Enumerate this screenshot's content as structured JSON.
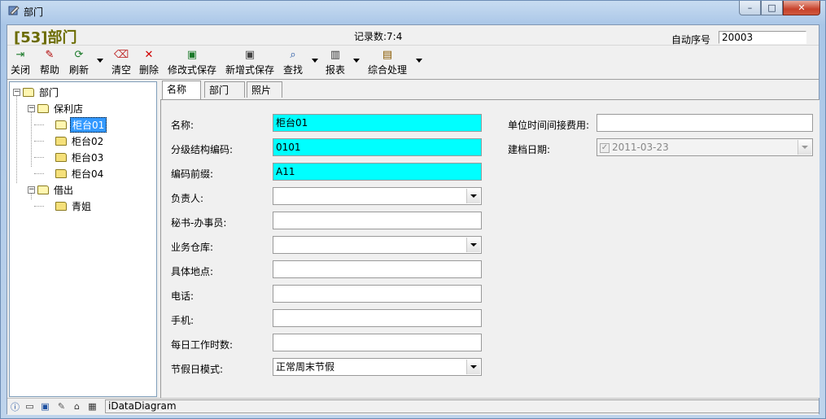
{
  "window": {
    "title": "部门",
    "controls": {
      "minimize": "–",
      "maximize": "□",
      "close": "✕"
    }
  },
  "header": {
    "page_title": "[53]部门",
    "record_count": "记录数:7:4",
    "auto_seq_label": "自动序号",
    "auto_seq_value": "20003"
  },
  "toolbar": {
    "items": [
      {
        "label": "关闭",
        "icon": "exit-door-icon",
        "glyph": "⇥"
      },
      {
        "label": "帮助",
        "icon": "help-book-icon",
        "glyph": "✎"
      },
      {
        "label": "刷新",
        "icon": "refresh-icon",
        "glyph": "⟳"
      },
      {
        "label": "清空",
        "icon": "eraser-icon",
        "glyph": "⌫"
      },
      {
        "label": "删除",
        "icon": "delete-x-icon",
        "glyph": "✕"
      },
      {
        "label": "修改式保存",
        "icon": "save-edit-icon",
        "glyph": "▣"
      },
      {
        "label": "新增式保存",
        "icon": "save-new-icon",
        "glyph": "▣"
      },
      {
        "label": "查找",
        "icon": "search-magnifier-icon",
        "glyph": "⌕"
      },
      {
        "label": "报表",
        "icon": "report-icon",
        "glyph": "▥"
      },
      {
        "label": "综合处理",
        "icon": "process-icon",
        "glyph": "▤"
      }
    ]
  },
  "tree": {
    "root": "部门",
    "groups": [
      {
        "label": "保利店",
        "children": [
          "柜台01",
          "柜台02",
          "柜台03",
          "柜台04"
        ]
      },
      {
        "label": "借出",
        "children": [
          "青姐"
        ]
      }
    ],
    "selected": "柜台01"
  },
  "tabs": [
    "名称",
    "部门类.",
    "照片"
  ],
  "form": {
    "left": [
      {
        "label": "名称:",
        "value": "柜台01",
        "type": "text",
        "highlight": true
      },
      {
        "label": "分级结构编码:",
        "value": "0101",
        "type": "text",
        "highlight": true
      },
      {
        "label": "编码前缀:",
        "value": "A11",
        "type": "text",
        "highlight": true
      },
      {
        "label": "负责人:",
        "value": "",
        "type": "select"
      },
      {
        "label": "秘书-办事员:",
        "value": "",
        "type": "text"
      },
      {
        "label": "业务仓库:",
        "value": "",
        "type": "select"
      },
      {
        "label": "具体地点:",
        "value": "",
        "type": "text"
      },
      {
        "label": "电话:",
        "value": "",
        "type": "text"
      },
      {
        "label": "手机:",
        "value": "",
        "type": "text"
      },
      {
        "label": "每日工作时数:",
        "value": "",
        "type": "text"
      },
      {
        "label": "节假日模式:",
        "value": "正常周末节假",
        "type": "select"
      }
    ],
    "right": {
      "cost_label": "单位时间间接费用:",
      "cost_value": "",
      "date_label": "建档日期:",
      "date_value": "2011-03-23"
    }
  },
  "colors": {
    "highlight_field": "#00ffff",
    "title_color": "#6b6b00",
    "selection": "#3399ff"
  },
  "statusbar": {
    "icons": [
      "info-icon",
      "computer-icon",
      "window-icon",
      "edit-icon",
      "network-icon",
      "calculator-icon"
    ],
    "text": "iDataDiagram"
  }
}
